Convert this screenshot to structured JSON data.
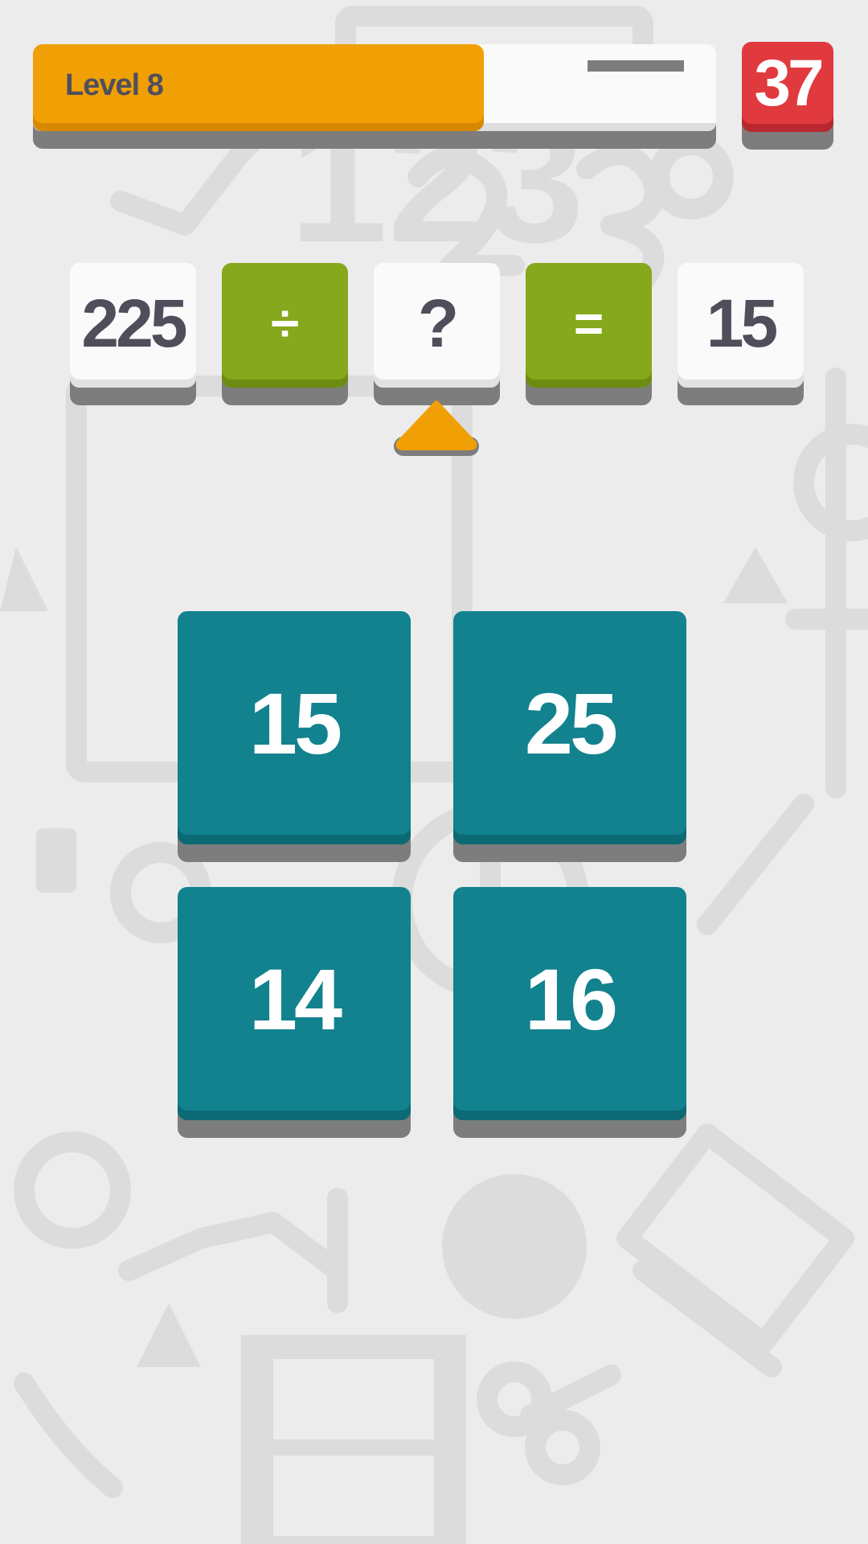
{
  "header": {
    "level_label": "Level 8",
    "timer_value": "37",
    "level_progress": 0.66
  },
  "equation": {
    "operand_left": "225",
    "operator": "÷",
    "unknown": "?",
    "equals": "=",
    "result": "15"
  },
  "answers": [
    {
      "label": "15"
    },
    {
      "label": "25"
    },
    {
      "label": "14"
    },
    {
      "label": "16"
    }
  ],
  "colors": {
    "progress_fill": "#f0a005",
    "timer_bg": "#e03a3f",
    "operator_tile": "#86a81c",
    "answer_tile": "#12828e",
    "text_dark": "#4f4f5c",
    "background": "#ececec",
    "background_doodles": "#dcdcdc"
  },
  "icons": {
    "pointer": "caret-up-icon",
    "background": "school-doodles-pattern"
  }
}
